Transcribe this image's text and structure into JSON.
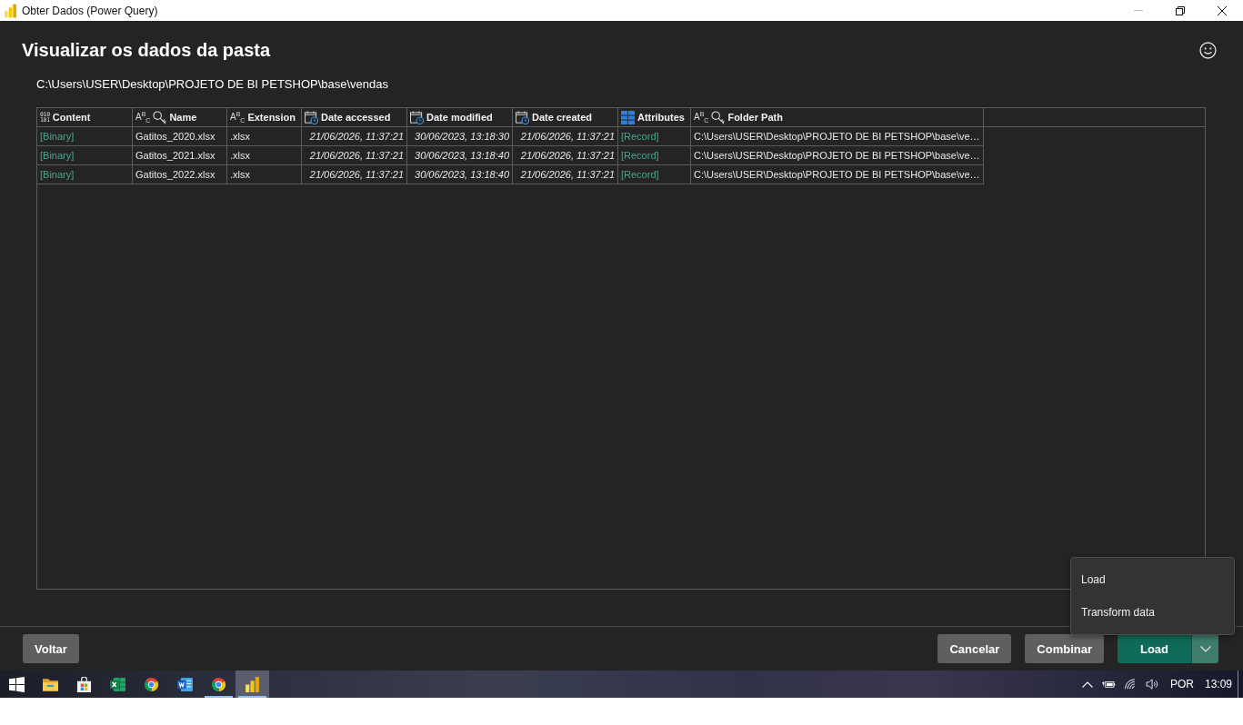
{
  "window": {
    "title": "Obter Dados (Power Query)"
  },
  "dialog": {
    "heading": "Visualizar os dados da pasta",
    "path": "C:\\Users\\USER\\Desktop\\PROJETO DE BI PETSHOP\\base\\vendas"
  },
  "table": {
    "columns": [
      {
        "label": "Content",
        "kind": "binary",
        "type_glyph": [
          "010",
          "101"
        ],
        "key": false
      },
      {
        "label": "Name",
        "kind": "text",
        "type_glyph": [
          "A$^{B}$$_{C}$"
        ],
        "key": true
      },
      {
        "label": "Extension",
        "kind": "text",
        "type_glyph": [
          "A$^{B}$$_{C}$"
        ],
        "key": false
      },
      {
        "label": "Date accessed",
        "kind": "datetime",
        "key": false
      },
      {
        "label": "Date modified",
        "kind": "datetime",
        "key": false
      },
      {
        "label": "Date created",
        "kind": "datetime",
        "key": false
      },
      {
        "label": "Attributes",
        "kind": "record",
        "key": false
      },
      {
        "label": "Folder Path",
        "kind": "text",
        "type_glyph": [
          "A$^{B}$$_{C}$"
        ],
        "key": true
      }
    ],
    "rows": [
      [
        "[Binary]",
        "Gatitos_2020.xlsx",
        ".xlsx",
        "21/06/2026, 11:37:21",
        "30/06/2023, 13:18:30",
        "21/06/2026, 11:37:21",
        "[Record]",
        "C:\\Users\\USER\\Desktop\\PROJETO DE BI PETSHOP\\base\\ve…"
      ],
      [
        "[Binary]",
        "Gatitos_2021.xlsx",
        ".xlsx",
        "21/06/2026, 11:37:21",
        "30/06/2023, 13:18:40",
        "21/06/2026, 11:37:21",
        "[Record]",
        "C:\\Users\\USER\\Desktop\\PROJETO DE BI PETSHOP\\base\\ve…"
      ],
      [
        "[Binary]",
        "Gatitos_2022.xlsx",
        ".xlsx",
        "21/06/2026, 11:37:21",
        "30/06/2023, 13:18:40",
        "21/06/2026, 11:37:21",
        "[Record]",
        "C:\\Users\\USER\\Desktop\\PROJETO DE BI PETSHOP\\base\\ve…"
      ]
    ]
  },
  "footer": {
    "back_button": "Voltar",
    "buttons": [
      "Cancelar",
      "Combinar"
    ],
    "load_button": {
      "label": "Load",
      "expanded": true,
      "menu": [
        "Load",
        "Transform data"
      ]
    }
  },
  "taskbar": {
    "apps": [
      {
        "kind": "folder",
        "running": false,
        "selected": false
      },
      {
        "kind": "store",
        "running": false,
        "selected": false
      },
      {
        "kind": "spreadsheet",
        "running": false,
        "selected": false
      },
      {
        "kind": "browser",
        "running": false,
        "selected": false
      },
      {
        "kind": "document",
        "running": false,
        "selected": false
      },
      {
        "kind": "browser",
        "running": true,
        "selected": false
      },
      {
        "kind": "chart",
        "running": true,
        "selected": true
      }
    ],
    "tray": {
      "language": "POR",
      "time": "13:09"
    }
  }
}
